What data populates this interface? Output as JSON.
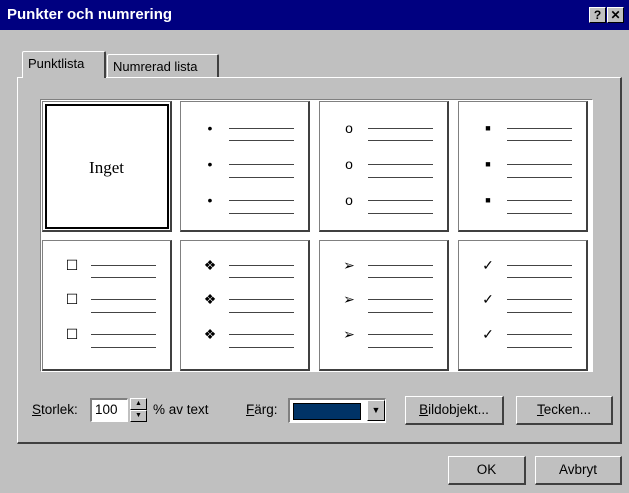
{
  "window": {
    "title": "Punkter och numrering",
    "help_label": "?",
    "close_label": "✕"
  },
  "tabs": [
    {
      "label": "Punktlista",
      "active": true
    },
    {
      "label": "Numrerad lista",
      "active": false
    }
  ],
  "bullet_styles": [
    {
      "name": "none",
      "label": "Inget",
      "selected": true
    },
    {
      "name": "small-dot",
      "glyph": "•"
    },
    {
      "name": "hollow-circle",
      "glyph": "o"
    },
    {
      "name": "filled-square",
      "glyph": "■"
    },
    {
      "name": "hollow-square",
      "glyph": "☐"
    },
    {
      "name": "four-diamond",
      "glyph": "❖"
    },
    {
      "name": "arrowhead",
      "glyph": "➢"
    },
    {
      "name": "checkmark",
      "glyph": "✓"
    }
  ],
  "size": {
    "label_accel": "S",
    "label_rest": "torlek:",
    "value": "100",
    "suffix": "% av text"
  },
  "color": {
    "label_accel": "F",
    "label_rest": "ärg:",
    "value": "#003366"
  },
  "buttons": {
    "picture_accel": "B",
    "picture_rest": "ildobjekt...",
    "character_accel": "T",
    "character_rest": "ecken...",
    "ok": "OK",
    "cancel": "Avbryt"
  }
}
